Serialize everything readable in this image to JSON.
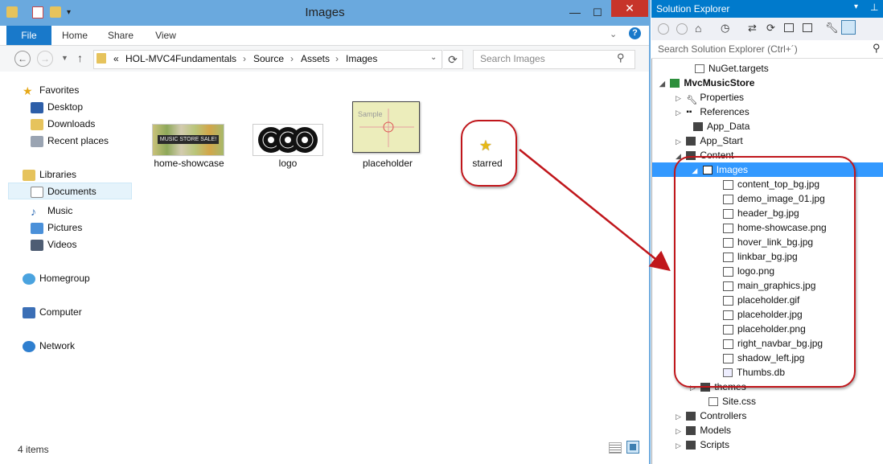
{
  "explorer": {
    "title": "Images",
    "tabs": [
      "File",
      "Home",
      "Share",
      "View"
    ],
    "breadcrumb": [
      "«",
      "HOL-MVC4Fundamentals",
      "Source",
      "Assets",
      "Images"
    ],
    "search_placeholder": "Search Images",
    "nav": {
      "favorites": "Favorites",
      "desktop": "Desktop",
      "downloads": "Downloads",
      "recent": "Recent places",
      "libraries": "Libraries",
      "documents": "Documents",
      "music": "Music",
      "pictures": "Pictures",
      "videos": "Videos",
      "homegroup": "Homegroup",
      "computer": "Computer",
      "network": "Network"
    },
    "files": [
      {
        "name": "home-showcase"
      },
      {
        "name": "logo"
      },
      {
        "name": "placeholder"
      },
      {
        "name": "starred"
      }
    ],
    "thumb_texts": {
      "showcase": "MUSIC STORE SALE!",
      "placeholder": "Sample"
    },
    "status": "4 items"
  },
  "solution_explorer": {
    "title": "Solution Explorer",
    "search_placeholder": "Search Solution Explorer (Ctrl+´)",
    "items": [
      {
        "label": "NuGet.targets"
      },
      {
        "label": "MvcMusicStore"
      },
      {
        "label": "Properties"
      },
      {
        "label": "References"
      },
      {
        "label": "App_Data"
      },
      {
        "label": "App_Start"
      },
      {
        "label": "Content"
      },
      {
        "label": "Images"
      },
      {
        "label": "content_top_bg.jpg"
      },
      {
        "label": "demo_image_01.jpg"
      },
      {
        "label": "header_bg.jpg"
      },
      {
        "label": "home-showcase.png"
      },
      {
        "label": "hover_link_bg.jpg"
      },
      {
        "label": "linkbar_bg.jpg"
      },
      {
        "label": "logo.png"
      },
      {
        "label": "main_graphics.jpg"
      },
      {
        "label": "placeholder.gif"
      },
      {
        "label": "placeholder.jpg"
      },
      {
        "label": "placeholder.png"
      },
      {
        "label": "right_navbar_bg.jpg"
      },
      {
        "label": "shadow_left.jpg"
      },
      {
        "label": "Thumbs.db"
      },
      {
        "label": "themes"
      },
      {
        "label": "Site.css"
      },
      {
        "label": "Controllers"
      },
      {
        "label": "Models"
      },
      {
        "label": "Scripts"
      }
    ]
  },
  "colors": {
    "titlebar": "#6aa9de",
    "accent": "#1979ca",
    "vs_blue": "#007acc",
    "annotation": "#c0161b"
  }
}
